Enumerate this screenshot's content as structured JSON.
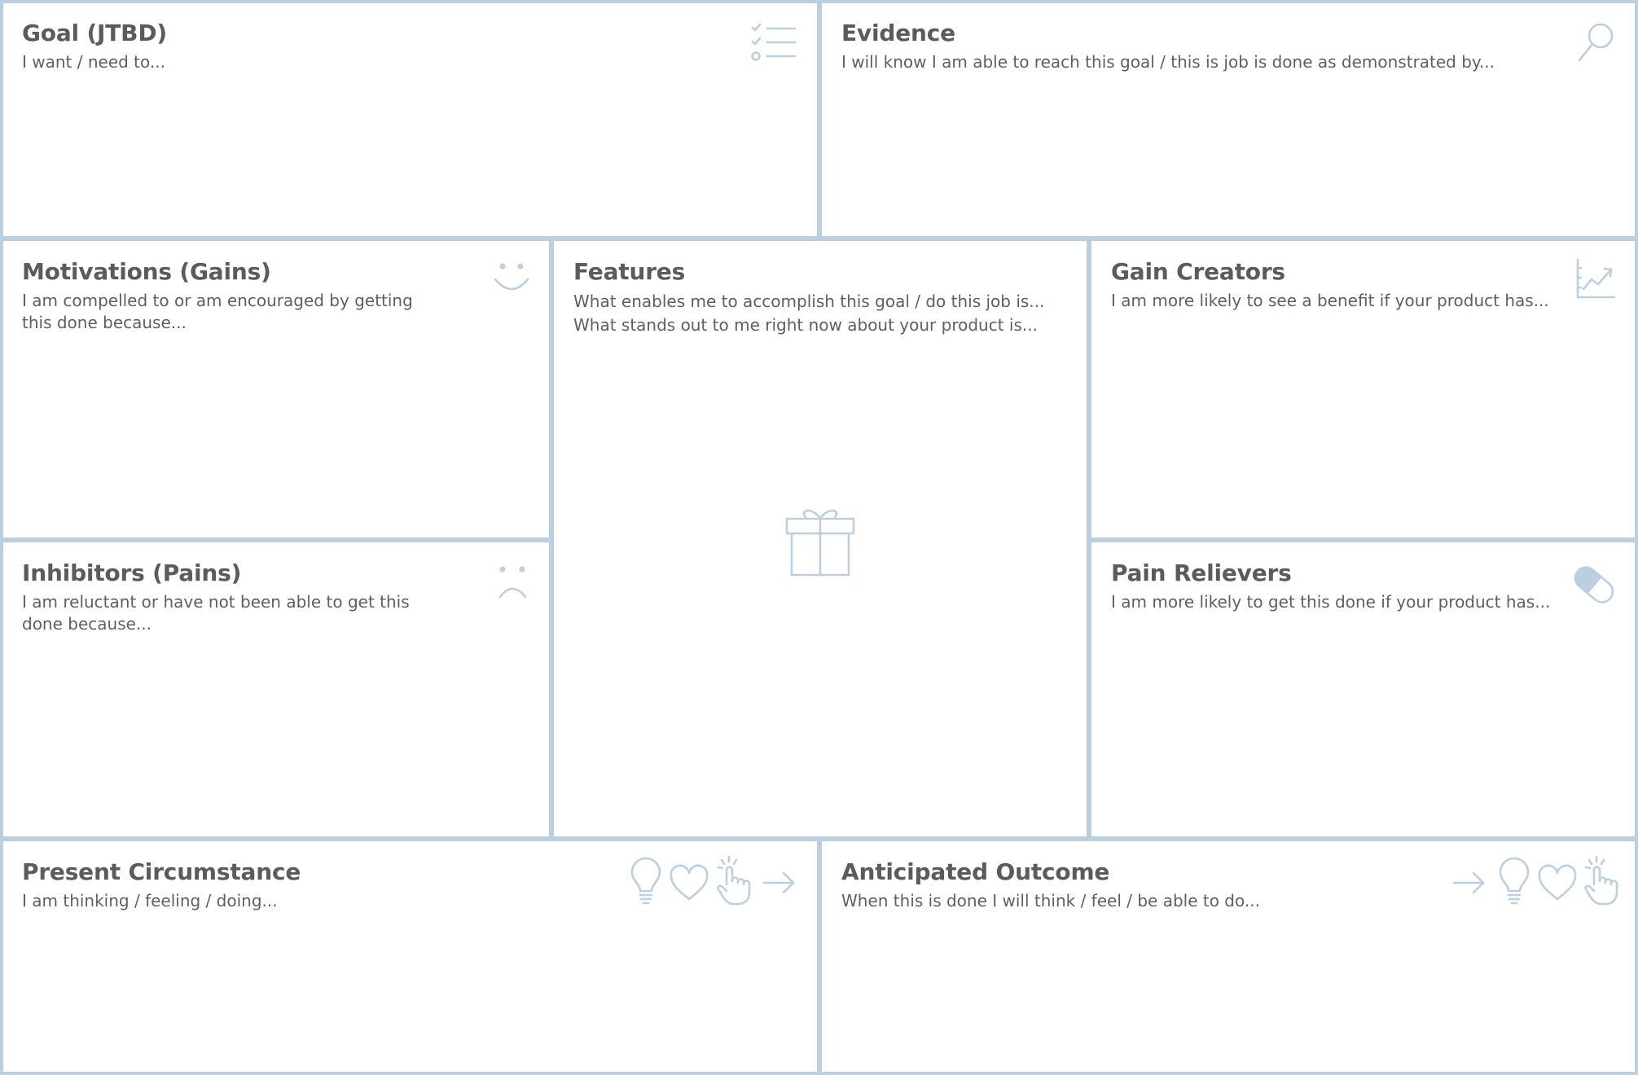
{
  "colors": {
    "grid": "#bccfe0",
    "icon": "#bccfe0",
    "text": "#5a5a5a",
    "background": "#ffffff"
  },
  "goal": {
    "title": "Goal (JTBD)",
    "desc": [
      "I want / need to..."
    ],
    "icons": [
      "checklist-icon"
    ]
  },
  "evidence": {
    "title": "Evidence",
    "desc": [
      "I will know I am able to reach this goal / this is job is done as demonstrated by..."
    ],
    "icons": [
      "magnifier-icon"
    ]
  },
  "motivations": {
    "title": "Motivations (Gains)",
    "desc": [
      "I am compelled to or am encouraged by getting",
      "this done because..."
    ],
    "icons": [
      "smile-icon"
    ]
  },
  "inhibitors": {
    "title": "Inhibitors (Pains)",
    "desc": [
      "I am reluctant or have not been able to get this",
      "done because..."
    ],
    "icons": [
      "frown-icon"
    ]
  },
  "features": {
    "title": "Features",
    "desc": [
      "What enables me to accomplish this goal / do this job is...",
      "What stands out to me right now about your product is..."
    ],
    "icons": [
      "gift-icon"
    ]
  },
  "gain_creators": {
    "title": "Gain Creators",
    "desc": [
      "I am more likely to see a benefit if your product has..."
    ],
    "icons": [
      "growth-chart-icon"
    ]
  },
  "pain_relievers": {
    "title": "Pain Relievers",
    "desc": [
      "I am more likely to get this done if your product has..."
    ],
    "icons": [
      "pill-icon"
    ]
  },
  "present": {
    "title": "Present Circumstance",
    "desc": [
      "I am thinking / feeling / doing..."
    ],
    "icons": [
      "lightbulb-icon",
      "heart-icon",
      "hand-pointer-icon",
      "arrow-right-icon"
    ]
  },
  "anticipated": {
    "title": "Anticipated Outcome",
    "desc": [
      "When this is done I will think / feel / be able to do..."
    ],
    "icons": [
      "arrow-right-icon",
      "lightbulb-icon",
      "heart-icon",
      "hand-pointer-icon"
    ]
  }
}
